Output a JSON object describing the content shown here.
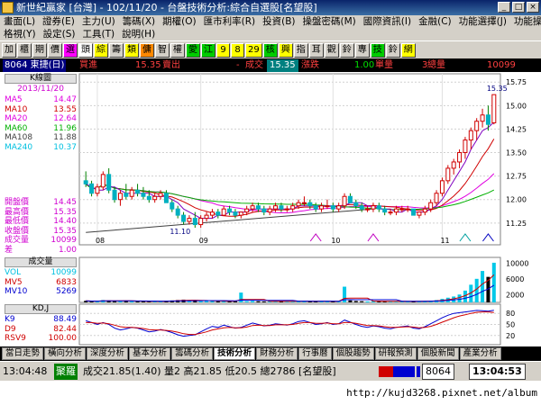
{
  "window": {
    "title": "新世紀贏家 [台灣] - 102/11/20 - 台盤技術分析:綜合自選股[名望股]"
  },
  "menu": {
    "row1": [
      "畫面(L)",
      "證券(E)",
      "主力(U)",
      "籌碼(X)",
      "期權(O)",
      "匯市利率(R)",
      "投資(B)",
      "操盤密碼(M)",
      "國際資訊(I)",
      "金融(C)",
      "功能選擇(J)",
      "功能操作(K)"
    ],
    "row2": [
      "格視(Y)",
      "設定(S)",
      "工具(T)",
      "說明(H)"
    ]
  },
  "toolbar": [
    "加",
    "櫃",
    "期",
    "價",
    "選",
    "頭",
    "綜",
    "籌",
    "類",
    "傭",
    "智",
    "權",
    "愛",
    "江",
    "9",
    "8",
    "29",
    "核",
    "興",
    "指",
    "耳",
    "觀",
    "鈴",
    "專",
    "技",
    "鈴",
    "網"
  ],
  "quote": {
    "code_name": "8064 東捷(日)",
    "buy_label": "買進",
    "buy": "15.35",
    "sell_label": "賣出",
    "sell": "-",
    "trade_label": "成交",
    "trade": "15.35",
    "change_label": "漲跌",
    "change": "1.00",
    "volume_label": "單量",
    "volume": "3",
    "total_label": "總量",
    "total": "10099"
  },
  "kline": {
    "panel_title": "K線圖",
    "date": "2013/11/20",
    "ma": [
      {
        "name": "MA5",
        "value": "14.47",
        "color": "#e000e0"
      },
      {
        "name": "MA10",
        "value": "13.55",
        "color": "#d00000"
      },
      {
        "name": "MA20",
        "value": "12.64",
        "color": "#e000e0"
      },
      {
        "name": "MA60",
        "value": "11.96",
        "color": "#00b000"
      },
      {
        "name": "MA108",
        "value": "11.88",
        "color": "#404040"
      },
      {
        "name": "MA240",
        "value": "10.37",
        "color": "#00c0e0"
      }
    ],
    "stats": [
      {
        "name": "開盤價",
        "value": "14.45",
        "color": "#d000d0"
      },
      {
        "name": "最高價",
        "value": "15.35",
        "color": "#d000d0"
      },
      {
        "name": "最低價",
        "value": "14.40",
        "color": "#d000d0"
      },
      {
        "name": "收盤價",
        "value": "15.35",
        "color": "#d000d0"
      },
      {
        "name": "成交量",
        "value": "10099",
        "color": "#d000d0"
      },
      {
        "name": "差",
        "value": "1.00",
        "color": "#d000d0"
      }
    ],
    "low_marker": "11.10",
    "high_marker": "15.35"
  },
  "volume_panel": {
    "title": "成交量",
    "items": [
      {
        "name": "VOL",
        "value": "10099",
        "color": "#00c0e0"
      },
      {
        "name": "MV5",
        "value": "6833",
        "color": "#d00000"
      },
      {
        "name": "MV10",
        "value": "5269",
        "color": "#0000d0"
      }
    ]
  },
  "kd_panel": {
    "title": "KD,J",
    "items": [
      {
        "name": "K9",
        "value": "88.49",
        "color": "#0000d0"
      },
      {
        "name": "D9",
        "value": "82.44",
        "color": "#d00000"
      },
      {
        "name": "RSV9",
        "value": "100.00",
        "color": "#d00000"
      }
    ]
  },
  "chart_data": {
    "type": "candlestick",
    "x_labels": [
      "08",
      "09",
      "10",
      "11"
    ],
    "price_axis": [
      "15.75",
      "15.00",
      "14.25",
      "13.50",
      "12.75",
      "12.00",
      "11.25"
    ],
    "price_range": [
      10.9,
      15.9
    ],
    "volume_axis": [
      "10000",
      "6000",
      "2000"
    ],
    "volume_max": 11000,
    "kd_axis": [
      "80",
      "50",
      "20"
    ],
    "candles": [
      [
        12.6,
        12.9,
        12.4,
        12.5
      ],
      [
        12.5,
        12.6,
        12.1,
        12.2
      ],
      [
        12.2,
        12.5,
        12.1,
        12.4
      ],
      [
        12.4,
        12.9,
        12.3,
        12.8
      ],
      [
        12.8,
        13.0,
        12.2,
        12.3
      ],
      [
        12.3,
        12.4,
        11.9,
        12.0
      ],
      [
        12.0,
        12.3,
        11.8,
        12.2
      ],
      [
        12.2,
        12.5,
        12.0,
        12.1
      ],
      [
        12.1,
        12.4,
        12.0,
        12.3
      ],
      [
        12.3,
        12.5,
        12.1,
        12.2
      ],
      [
        12.2,
        12.4,
        12.0,
        12.1
      ],
      [
        12.1,
        12.3,
        11.9,
        12.0
      ],
      [
        12.0,
        12.2,
        11.9,
        12.1
      ],
      [
        12.1,
        12.3,
        12.0,
        12.2
      ],
      [
        12.2,
        12.3,
        11.9,
        11.9
      ],
      [
        11.9,
        12.0,
        11.6,
        11.7
      ],
      [
        11.7,
        11.8,
        11.4,
        11.5
      ],
      [
        11.5,
        11.6,
        11.2,
        11.3
      ],
      [
        11.3,
        11.5,
        11.2,
        11.4
      ],
      [
        11.4,
        11.6,
        11.1,
        11.2
      ],
      [
        11.2,
        11.5,
        11.1,
        11.4
      ],
      [
        11.4,
        11.6,
        11.3,
        11.5
      ],
      [
        11.5,
        11.7,
        11.4,
        11.6
      ],
      [
        11.6,
        11.7,
        11.4,
        11.5
      ],
      [
        11.5,
        11.8,
        11.5,
        11.7
      ],
      [
        11.7,
        11.8,
        11.5,
        11.6
      ],
      [
        11.6,
        11.7,
        11.4,
        11.5
      ],
      [
        11.5,
        11.6,
        11.4,
        11.6
      ],
      [
        11.6,
        11.8,
        11.5,
        11.7
      ],
      [
        11.7,
        11.9,
        11.6,
        11.8
      ],
      [
        11.8,
        11.9,
        11.6,
        11.7
      ],
      [
        11.7,
        11.8,
        11.5,
        11.6
      ],
      [
        11.6,
        11.8,
        11.5,
        11.7
      ],
      [
        11.7,
        11.9,
        11.6,
        11.8
      ],
      [
        11.8,
        11.9,
        11.6,
        11.7
      ],
      [
        11.7,
        11.8,
        11.6,
        11.7
      ],
      [
        11.7,
        11.9,
        11.6,
        11.8
      ],
      [
        11.8,
        12.0,
        11.7,
        11.9
      ],
      [
        11.9,
        12.1,
        11.8,
        11.9
      ],
      [
        11.9,
        12.0,
        11.7,
        11.8
      ],
      [
        11.8,
        11.9,
        11.6,
        11.7
      ],
      [
        11.7,
        11.9,
        11.6,
        11.8
      ],
      [
        11.8,
        12.0,
        11.7,
        11.8
      ],
      [
        11.8,
        11.9,
        11.6,
        11.7
      ],
      [
        11.7,
        11.9,
        11.6,
        11.8
      ],
      [
        11.8,
        12.2,
        11.7,
        12.1
      ],
      [
        12.1,
        12.2,
        11.9,
        11.9
      ],
      [
        11.9,
        12.0,
        11.7,
        11.8
      ],
      [
        11.8,
        11.9,
        11.6,
        11.7
      ],
      [
        11.7,
        11.8,
        11.6,
        11.7
      ],
      [
        11.7,
        11.9,
        11.6,
        11.8
      ],
      [
        11.8,
        11.9,
        11.6,
        11.7
      ],
      [
        11.7,
        11.8,
        11.5,
        11.6
      ],
      [
        11.6,
        11.7,
        11.5,
        11.6
      ],
      [
        11.6,
        11.8,
        11.5,
        11.7
      ],
      [
        11.7,
        11.8,
        11.6,
        11.7
      ],
      [
        11.7,
        11.8,
        11.6,
        11.7
      ],
      [
        11.7,
        11.7,
        11.5,
        11.5
      ],
      [
        11.5,
        11.6,
        11.4,
        11.6
      ],
      [
        11.6,
        11.8,
        11.5,
        11.7
      ],
      [
        11.7,
        12.0,
        11.6,
        11.9
      ],
      [
        11.9,
        12.3,
        11.8,
        12.2
      ],
      [
        12.2,
        12.7,
        12.1,
        12.6
      ],
      [
        12.6,
        13.1,
        12.5,
        13.0
      ],
      [
        13.0,
        13.3,
        12.8,
        13.2
      ],
      [
        13.2,
        13.6,
        13.0,
        13.5
      ],
      [
        13.5,
        14.0,
        13.3,
        13.9
      ],
      [
        13.9,
        14.3,
        13.6,
        14.2
      ],
      [
        14.2,
        14.6,
        13.9,
        14.5
      ],
      [
        14.5,
        14.9,
        14.3,
        14.7
      ],
      [
        14.7,
        15.0,
        14.2,
        14.4
      ],
      [
        14.45,
        15.35,
        14.4,
        15.35
      ]
    ],
    "volumes": [
      400,
      300,
      250,
      600,
      500,
      350,
      300,
      400,
      350,
      300,
      250,
      200,
      300,
      350,
      400,
      500,
      600,
      700,
      500,
      550,
      300,
      350,
      400,
      300,
      350,
      250,
      300,
      2500,
      300,
      350,
      300,
      250,
      300,
      350,
      300,
      250,
      300,
      400,
      350,
      300,
      250,
      300,
      350,
      300,
      250,
      4000,
      500,
      350,
      300,
      250,
      300,
      350,
      300,
      250,
      300,
      350,
      300,
      250,
      300,
      350,
      400,
      600,
      900,
      1200,
      1500,
      2000,
      3000,
      4500,
      6000,
      8000,
      6500,
      10099
    ],
    "k": [
      60,
      55,
      50,
      55,
      50,
      40,
      35,
      38,
      42,
      40,
      35,
      30,
      32,
      36,
      33,
      28,
      22,
      18,
      20,
      22,
      30,
      38,
      45,
      42,
      48,
      44,
      40,
      42,
      48,
      54,
      50,
      46,
      48,
      52,
      50,
      48,
      52,
      58,
      60,
      55,
      50,
      52,
      55,
      50,
      52,
      62,
      56,
      50,
      45,
      42,
      46,
      44,
      40,
      38,
      42,
      44,
      46,
      40,
      38,
      44,
      52,
      60,
      68,
      75,
      80,
      82,
      84,
      86,
      88,
      87,
      86,
      88.49
    ],
    "d": [
      55,
      55,
      53,
      54,
      52,
      48,
      44,
      42,
      42,
      41,
      39,
      36,
      35,
      35,
      34,
      32,
      29,
      25,
      23,
      23,
      26,
      30,
      35,
      38,
      41,
      42,
      41,
      41,
      43,
      47,
      48,
      47,
      47,
      49,
      49,
      49,
      50,
      53,
      55,
      55,
      53,
      53,
      54,
      52,
      52,
      55,
      55,
      53,
      50,
      47,
      47,
      46,
      44,
      42,
      42,
      43,
      44,
      43,
      41,
      42,
      45,
      50,
      56,
      62,
      68,
      73,
      76,
      80,
      83,
      84,
      84,
      82.44
    ],
    "ma_series": {
      "MA5": [
        12.5,
        12.4,
        12.3,
        12.3,
        12.4,
        12.4,
        12.3,
        12.2,
        12.2,
        12.2,
        12.2,
        12.2,
        12.1,
        12.1,
        12.1,
        12.0,
        11.9,
        11.7,
        11.6,
        11.5,
        11.4,
        11.4,
        11.4,
        11.5,
        11.5,
        11.6,
        11.6,
        11.6,
        11.6,
        11.7,
        11.7,
        11.7,
        11.7,
        11.7,
        11.7,
        11.7,
        11.7,
        11.8,
        11.8,
        11.8,
        11.8,
        11.8,
        11.8,
        11.8,
        11.8,
        11.8,
        11.9,
        11.9,
        11.9,
        11.8,
        11.8,
        11.7,
        11.7,
        11.7,
        11.6,
        11.6,
        11.7,
        11.6,
        11.6,
        11.6,
        11.7,
        11.8,
        12.0,
        12.3,
        12.6,
        12.9,
        13.2,
        13.6,
        13.9,
        14.2,
        14.3,
        14.47
      ]
    }
  },
  "tabs": [
    "當日走勢",
    "橫向分析",
    "深度分析",
    "基本分析",
    "籌碼分析",
    "技術分析",
    "財務分析",
    "行事曆",
    "個股趨勢",
    "研報預測",
    "個股新聞",
    "產業分析"
  ],
  "active_tab": "技術分析",
  "status": {
    "time1": "13:04:48",
    "tag": "聚羅",
    "text": "成交21.85(1.40) 量2 高21.85 低20.5 總2786 [名望股]",
    "code": "8064",
    "time2": "13:04:53"
  },
  "watermark": "http://kujd3268.pixnet.net/album"
}
